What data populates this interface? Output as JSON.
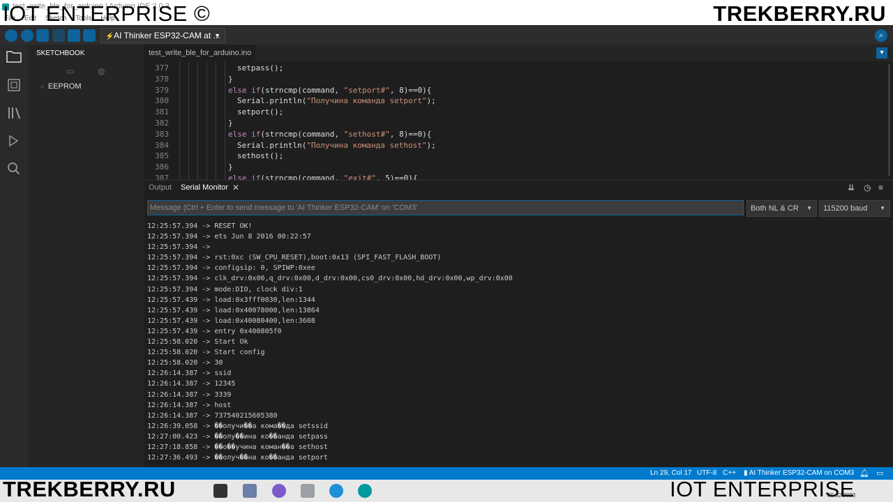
{
  "watermarks": {
    "top_left": "IOT ENTERPRISE ©",
    "top_right": "TREKBERRY.RU",
    "bottom_left": "TREKBERRY.RU",
    "bottom_right": "IOT ENTERPRISE"
  },
  "window": {
    "title": "test_write_ble_for_arduino | Arduino IDE 2.0.3",
    "menu": [
      "File",
      "Edit",
      "Sketch",
      "Tools",
      "Help"
    ]
  },
  "toolbar": {
    "board_selector": "AI Thinker ESP32-CAM at ..."
  },
  "sidebar": {
    "title": "SKETCHBOOK",
    "items": [
      {
        "label": "EEPROM"
      }
    ]
  },
  "editor": {
    "file_tab": "test_write_ble_for_arduino.ino",
    "lines": [
      {
        "num": "377",
        "code": "setpass();"
      },
      {
        "num": "378",
        "code": "}"
      },
      {
        "num": "379",
        "code": "else if(strncmp(command, \"setport#\", 8)==0){"
      },
      {
        "num": "380",
        "code": "Serial.println(\"Получина команда setport\");"
      },
      {
        "num": "381",
        "code": "setport();"
      },
      {
        "num": "382",
        "code": "}"
      },
      {
        "num": "383",
        "code": "else if(strncmp(command, \"sethost#\", 8)==0){"
      },
      {
        "num": "384",
        "code": "Serial.println(\"Получина команда sethost\");"
      },
      {
        "num": "385",
        "code": "sethost();"
      },
      {
        "num": "386",
        "code": "}"
      },
      {
        "num": "387",
        "code": "else if(strncmp(command, \"exit#\", 5)==0){"
      }
    ]
  },
  "panel": {
    "tabs": [
      "Output",
      "Serial Monitor"
    ],
    "message_placeholder": "Message (Ctrl + Enter to send message to 'AI Thinker ESP32-CAM' on 'COM3'",
    "line_ending": "Both NL & CR",
    "baud": "115200 baud",
    "log": [
      "12:25:57.394 -> RESET OK!",
      "12:25:57.394 -> ets Jun 8 2016 00:22:57",
      "12:25:57.394 ->",
      "12:25:57.394 -> rst:0xc (SW_CPU_RESET),boot:0x13 (SPI_FAST_FLASH_BOOT)",
      "12:25:57.394 -> configsip: 0, SPIWP:0xee",
      "12:25:57.394 -> clk_drv:0x00,q_drv:0x00,d_drv:0x00,cs0_drv:0x00,hd_drv:0x00,wp_drv:0x00",
      "12:25:57.394 -> mode:DIO, clock div:1",
      "12:25:57.439 -> load:0x3fff0030,len:1344",
      "12:25:57.439 -> load:0x40078000,len:13864",
      "12:25:57.439 -> load:0x40080400,len:3608",
      "12:25:57.439 -> entry 0x400805f0",
      "12:25:58.020 -> Start Ok",
      "12:25:58.020 -> Start config",
      "12:25:58.020 -> 30",
      "12:26:14.387 -> ssid",
      "12:26:14.387 -> 12345",
      "12:26:14.387 -> 3339",
      "12:26:14.387 -> host",
      "12:26:14.387 -> 737540215605380",
      "12:26:39.058 -> ��олучи��а кома��да setssid",
      "12:27:00.423 -> ��олу��ина ко��анда setpass",
      "12:27:18.858 -> ��о��учина коман��а sethost",
      "12:27:36.493 -> ��олуч��на ко��анда setport"
    ]
  },
  "statusbar": {
    "position": "Ln 29, Col 17",
    "encoding": "UTF-8",
    "language": "C++",
    "board": "AI Thinker ESP32-CAM on COM3"
  },
  "taskbar": {
    "date": "09.02.2023"
  },
  "colors": {
    "accent": "#007acc",
    "button": "#0e639c",
    "editor_bg": "#1e1e1e",
    "sidebar_bg": "#252526",
    "string": "#ce9178",
    "keyword": "#c586c0"
  }
}
